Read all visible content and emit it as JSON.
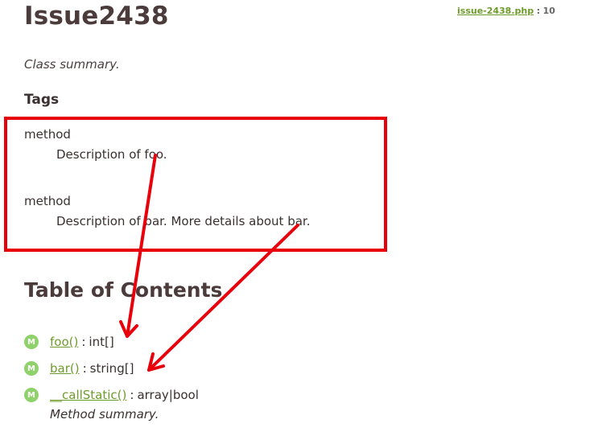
{
  "header": {
    "title": "Issue2438",
    "source_file": "issue-2438.php",
    "source_separator": ":",
    "source_line": "10"
  },
  "summary": "Class summary.",
  "tags": {
    "heading": "Tags",
    "items": [
      {
        "name": "method",
        "description": "Description of foo."
      },
      {
        "name": "method",
        "description": "Description of bar. More details about bar."
      }
    ]
  },
  "toc": {
    "heading": "Table of Contents",
    "badge": "M",
    "items": [
      {
        "link": "foo()",
        "separator": ":",
        "type": "int[]"
      },
      {
        "link": "bar()",
        "separator": ":",
        "type": "string[]"
      },
      {
        "link": "__callStatic()",
        "separator": ":",
        "type": "array|bool",
        "summary": "Method summary."
      }
    ]
  },
  "colors": {
    "link": "#6e9b2c",
    "badge": "#8fd16a",
    "annotation": "#e8000b",
    "heading": "#4b3b3b"
  }
}
